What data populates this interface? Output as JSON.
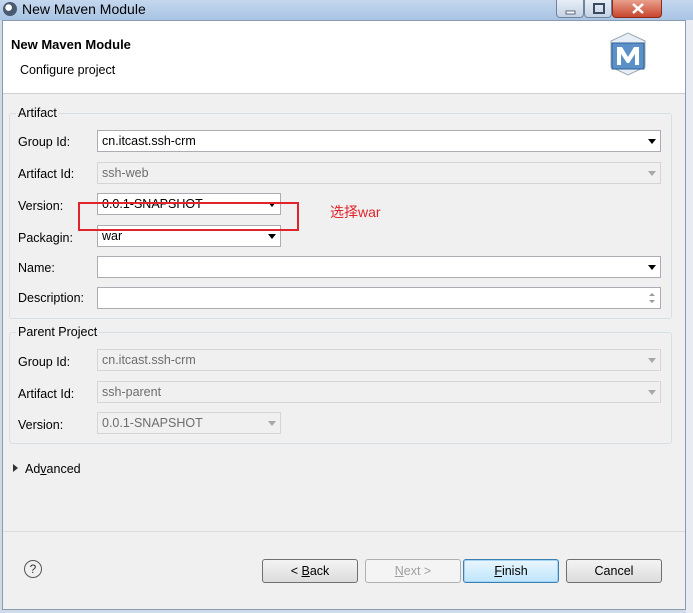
{
  "window": {
    "title": "New Maven Module"
  },
  "header": {
    "title": "New Maven Module",
    "subtitle": "Configure project"
  },
  "artifact": {
    "legend": "Artifact",
    "group_id": {
      "label": "Group Id:",
      "value": "cn.itcast.ssh-crm"
    },
    "artifact_id": {
      "label": "Artifact Id:",
      "value": "ssh-web"
    },
    "version": {
      "label": "Version:",
      "value": "0.0.1-SNAPSHOT"
    },
    "packaging": {
      "label_pre": "Packagin",
      "label_post": ":",
      "value": "war"
    },
    "name": {
      "label": "Name:",
      "value": ""
    },
    "description": {
      "label": "Description:",
      "value": ""
    }
  },
  "annotation": "选择war",
  "parent": {
    "legend": "Parent Project",
    "group_id": {
      "label": "Group Id:",
      "value": "cn.itcast.ssh-crm"
    },
    "artifact_id": {
      "label": "Artifact Id:",
      "value": "ssh-parent"
    },
    "version": {
      "label": "Version:",
      "value": "0.0.1-SNAPSHOT"
    }
  },
  "advanced": {
    "pre": "Ad",
    "mnemonic": "v",
    "post": "anced"
  },
  "buttons": {
    "help": "?",
    "back": {
      "pre": "< ",
      "mnemonic": "B",
      "post": "ack"
    },
    "next": {
      "mnemonic": "N",
      "post": "ext >"
    },
    "finish": {
      "mnemonic": "F",
      "post": "inish"
    },
    "cancel": "Cancel"
  },
  "colors": {
    "annotation": "#e0242c",
    "titlebar": "#b9cfe9",
    "dialog_bg": "#f0f0f0"
  }
}
